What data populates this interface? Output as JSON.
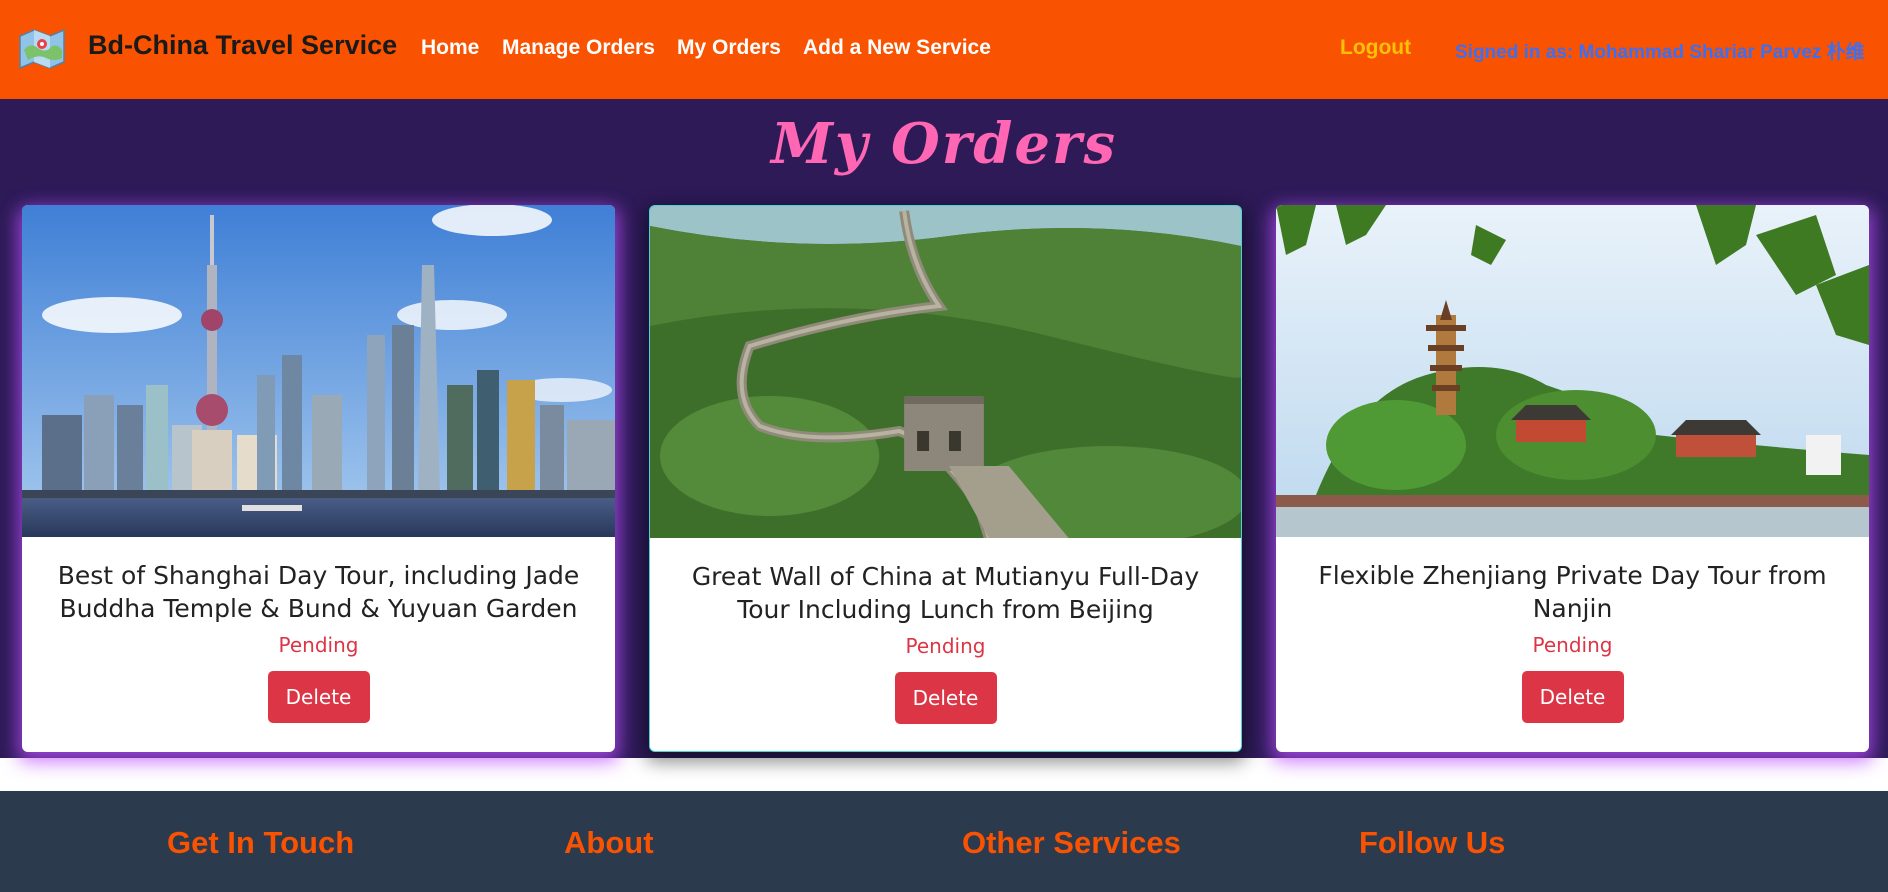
{
  "navbar": {
    "brand": "Bd-China Travel Service",
    "links": [
      "Home",
      "Manage Orders",
      "My Orders",
      "Add a New Service"
    ],
    "logout": "Logout",
    "signed_in": "Signed in as: Mohammad Shariar Parvez 朴维",
    "logo_icon": "map-logo-icon",
    "colors": {
      "background": "#f95200",
      "logout": "#ffc107",
      "signed_in": "#3d6ff2"
    }
  },
  "main": {
    "title": "My Orders",
    "colors": {
      "background": "#2d1a57",
      "title": "#ff66b3"
    },
    "orders": [
      {
        "title": "Best of Shanghai Day Tour, including Jade Buddha Temple & Bund & Yuyuan Garden",
        "status": "Pending",
        "delete_label": "Delete"
      },
      {
        "title": "Great Wall of China at Mutianyu Full-Day Tour Including Lunch from Beijing",
        "status": "Pending",
        "delete_label": "Delete"
      },
      {
        "title": "Flexible Zhenjiang Private Day Tour from Nanjin",
        "status": "Pending",
        "delete_label": "Delete"
      }
    ]
  },
  "footer": {
    "headings": [
      "Get In Touch",
      "About",
      "Other Services",
      "Follow Us"
    ],
    "colors": {
      "background": "#2c3a4e",
      "heading": "#f95200"
    }
  }
}
